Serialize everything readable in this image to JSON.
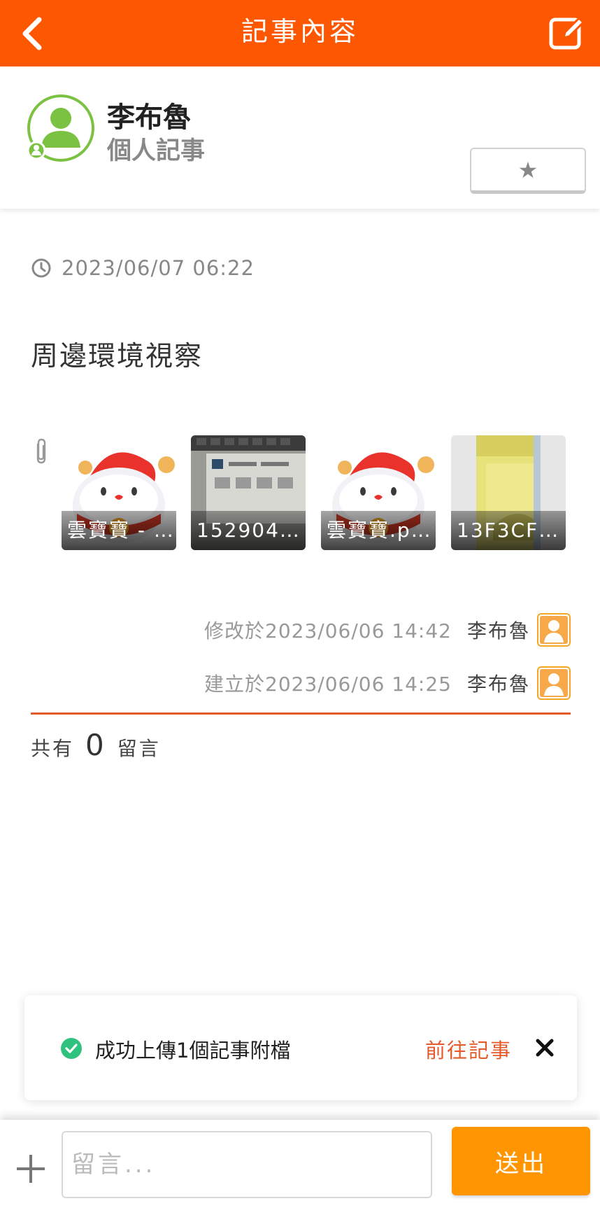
{
  "header": {
    "title": "記事內容",
    "back_icon": "chevron-left-icon",
    "edit_icon": "edit-icon"
  },
  "profile": {
    "name": "李布魯",
    "subtitle": "個人記事",
    "favorite_icon": "star-icon"
  },
  "post": {
    "datetime": "2023/06/07 06:22",
    "title": "周邊環境視察"
  },
  "attachments": [
    {
      "caption": "雲寶寶 - …",
      "kind": "mascot"
    },
    {
      "caption": "152904…",
      "kind": "photo-dark"
    },
    {
      "caption": "雲寶寶.p…",
      "kind": "mascot"
    },
    {
      "caption": "13F3CF…",
      "kind": "photo-yellow"
    }
  ],
  "meta": {
    "modified": {
      "when": "修改於2023/06/06 14:42",
      "who": "李布魯"
    },
    "created": {
      "when": "建立於2023/06/06 14:25",
      "who": "李布魯"
    }
  },
  "comments": {
    "prefix": "共有",
    "count": "0",
    "suffix": "留言"
  },
  "toast": {
    "message": "成功上傳1個記事附檔",
    "link": "前往記事"
  },
  "composer": {
    "placeholder": "留言...",
    "send_label": "送出"
  },
  "colors": {
    "brand": "#fe5701",
    "accent": "#e55a2b",
    "send": "#ff9500",
    "success": "#2ec27e"
  }
}
